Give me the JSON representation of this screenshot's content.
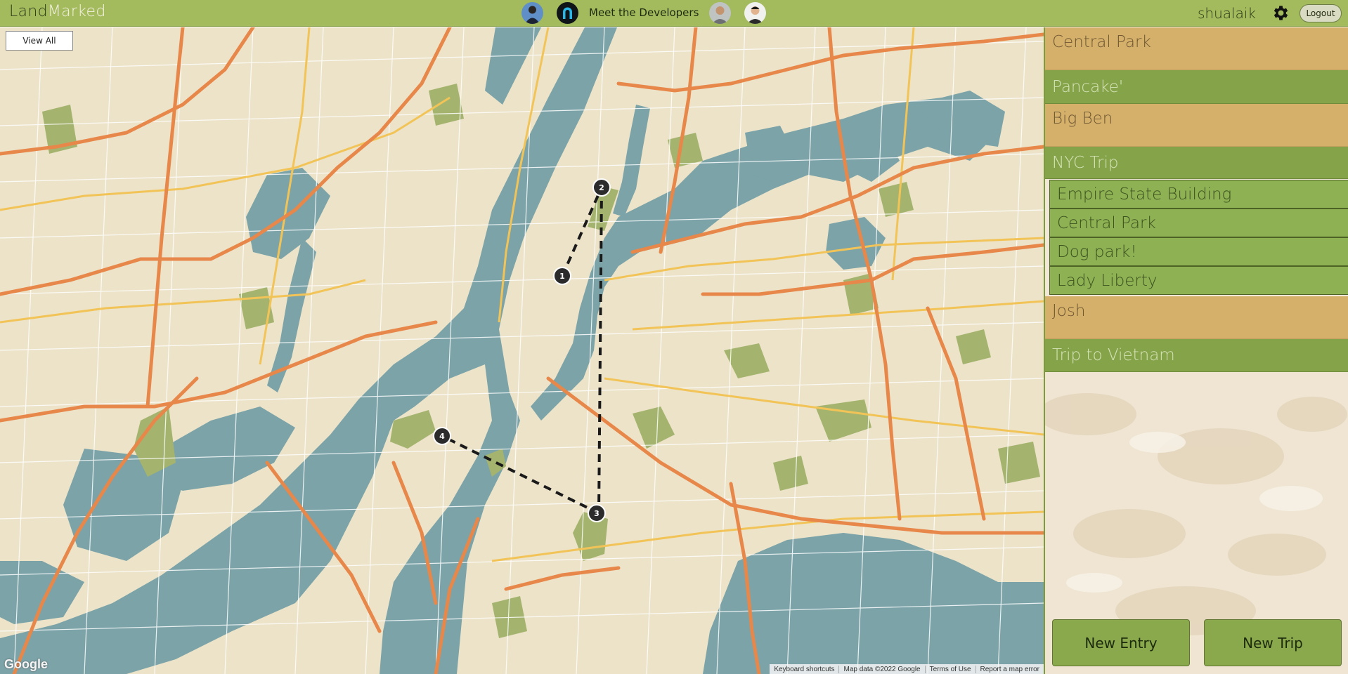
{
  "header": {
    "logo_part1": "Land",
    "logo_part2": "Marked",
    "meet_developers": "Meet the Developers",
    "username": "shualaik",
    "logout_label": "Logout"
  },
  "map": {
    "view_all_label": "View All",
    "google_label": "Google",
    "attribution": {
      "keyboard": "Keyboard shortcuts",
      "map_data": "Map data ©2022 Google",
      "terms": "Terms of Use",
      "report": "Report a map error"
    },
    "markers": [
      "1",
      "2",
      "3",
      "4"
    ]
  },
  "sidebar": {
    "items": [
      {
        "label": "Central Park",
        "type": "entry"
      },
      {
        "label": "Pancake'",
        "type": "trip"
      },
      {
        "label": "Big Ben",
        "type": "entry"
      },
      {
        "label": "NYC Trip",
        "type": "trip",
        "children": [
          "Empire State Building",
          "Central Park",
          "Dog park!",
          "Lady Liberty"
        ]
      },
      {
        "label": "Josh",
        "type": "entry"
      },
      {
        "label": "Trip to Vietnam",
        "type": "trip"
      }
    ],
    "new_entry_label": "New Entry",
    "new_trip_label": "New Trip"
  },
  "colors": {
    "header_green": "#a3bb5c",
    "entry_tan": "#d5b06b",
    "trip_green": "#85a44a",
    "water": "#7ba3a8",
    "land": "#ece3c9",
    "highway": "#e8874a",
    "road_yellow": "#f2c458",
    "park": "#a4b46e"
  }
}
